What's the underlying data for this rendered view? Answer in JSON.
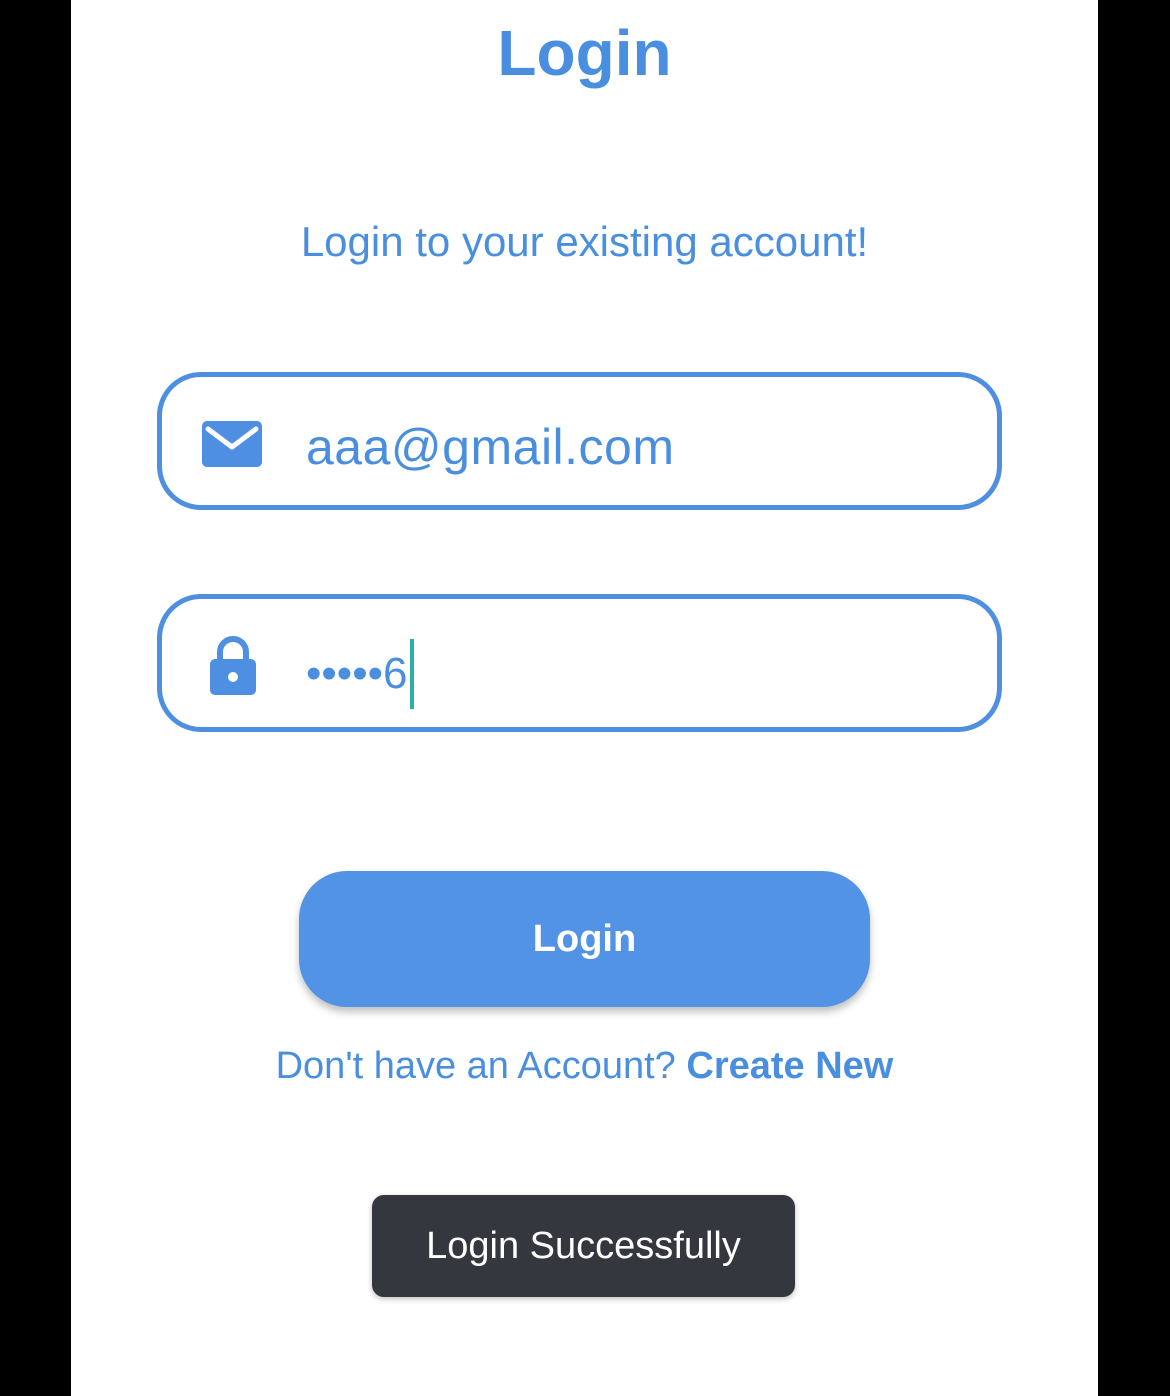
{
  "header": {
    "title": "Login",
    "subtitle": "Login to your existing account!"
  },
  "form": {
    "email": {
      "value": "aaa@gmail.com",
      "icon": "mail-icon"
    },
    "password": {
      "masked_value": "•••••6",
      "icon": "lock-icon"
    },
    "login_label": "Login"
  },
  "signup": {
    "prompt": "Don't have an Account?",
    "link_label": "Create New"
  },
  "toast": {
    "message": "Login Successfully"
  },
  "colors": {
    "accent": "#4a8fdf",
    "button": "#5393e6",
    "toast_bg": "#35373e",
    "caret": "#2bb0a8"
  }
}
